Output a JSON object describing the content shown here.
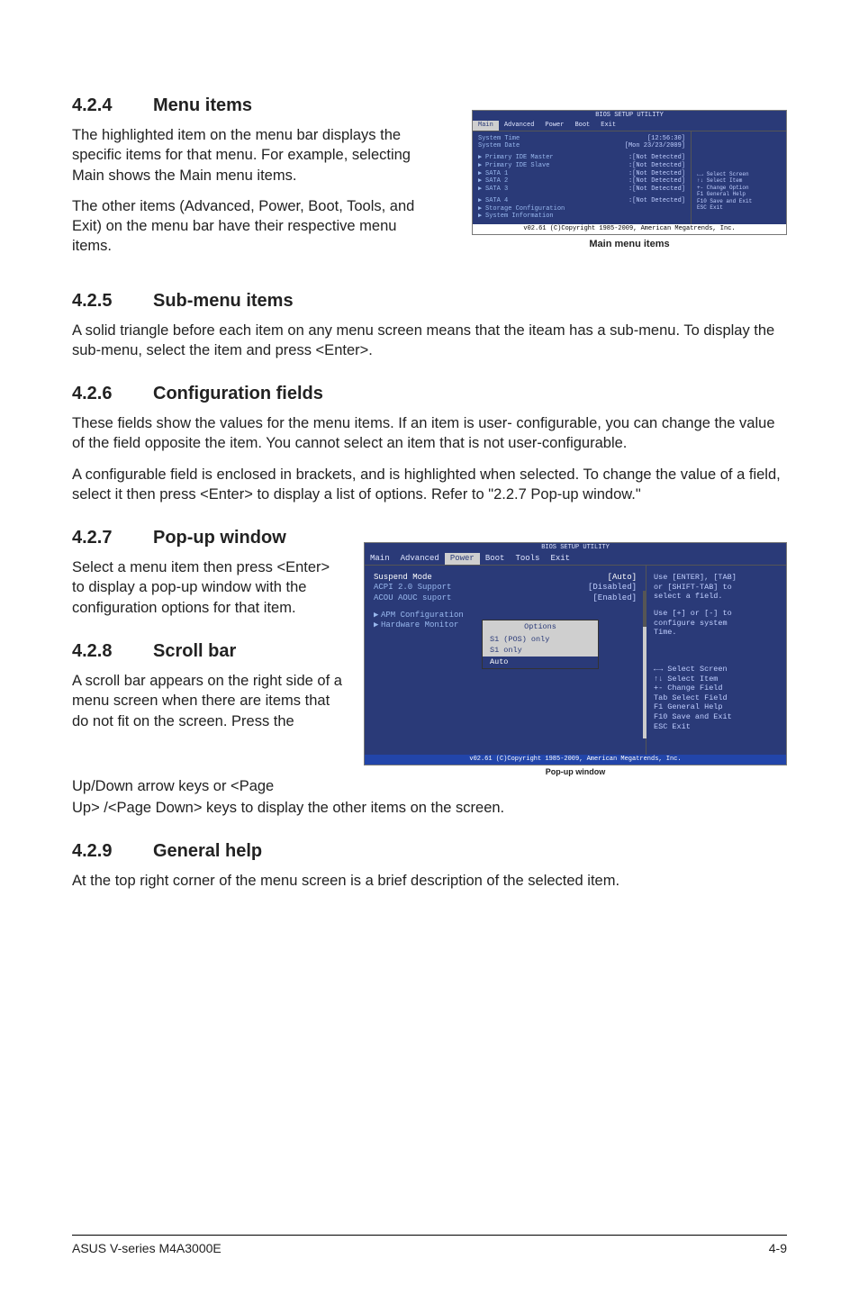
{
  "s1": {
    "num": "4.2.4",
    "title": "Menu items",
    "p1": "The highlighted item on the menu bar  displays the specific items for that menu. For example, selecting Main shows the Main menu items.",
    "p2": "The other items (Advanced, Power, Boot, Tools, and Exit) on the menu bar have their respective menu items."
  },
  "caption1": "Main menu items",
  "s2": {
    "num": "4.2.5",
    "title": "Sub-menu items",
    "p1": "A solid triangle before each item on any menu screen means that the iteam has a sub-menu. To display the sub-menu, select the item and press <Enter>."
  },
  "s3": {
    "num": "4.2.6",
    "title": "Configuration fields",
    "p1": "These fields show the values for the menu items. If an item is user- configurable, you can change the value of the field opposite the item. You cannot select an item that is not user-configurable.",
    "p2": "A configurable field is enclosed in brackets, and is highlighted when selected. To change the value of a field, select it then press <Enter> to display a list of options. Refer to \"2.2.7 Pop-up window.\""
  },
  "s4": {
    "num": "4.2.7",
    "title": "Pop-up window",
    "p1": "Select a menu item then press <Enter> to display a pop-up window with the configuration options for that item."
  },
  "s5": {
    "num": "4.2.8",
    "title": "Scroll bar",
    "p1": "A scroll bar appears on the right side of a menu screen when there are items that do not fit on the screen. Press the",
    "p2": "Up/Down arrow keys or <Page",
    "p3": "Up> /<Page Down> keys to display the other items on the screen."
  },
  "caption2": "Pop-up window",
  "s6": {
    "num": "4.2.9",
    "title": "General help",
    "p1": "At the top right corner of the menu screen is a brief description of the selected item."
  },
  "bios_small": {
    "title": "BIOS SETUP UTILITY",
    "tabs": [
      "Main",
      "Advanced",
      "Power",
      "Boot",
      "Exit"
    ],
    "rows": [
      {
        "lbl": "System Time",
        "val": "[12:56:30]"
      },
      {
        "lbl": "System Date",
        "val": "[Mon 23/23/2009]"
      }
    ],
    "submenus": [
      {
        "lbl": "Primary IDE Master",
        "val": ":[Not Detected]"
      },
      {
        "lbl": "Primary IDE Slave",
        "val": ":[Not Detected]"
      },
      {
        "lbl": "SATA 1",
        "val": ":[Not Detected]"
      },
      {
        "lbl": "SATA 2",
        "val": ":[Not Detected]"
      },
      {
        "lbl": "SATA 3",
        "val": ":[Not Detected]"
      }
    ],
    "submenus2": [
      {
        "lbl": "SATA 4",
        "val": ":[Not Detected]"
      },
      {
        "lbl": "Storage Configuration",
        "val": ""
      },
      {
        "lbl": "System Information",
        "val": ""
      }
    ],
    "help": [
      "←→   Select Screen",
      "↑↓   Select Item",
      "+-   Change Option",
      "F1   General Help",
      "F10  Save and Exit",
      "ESC  Exit"
    ],
    "footer": "v02.61 (C)Copyright 1985-2009, American Megatrends, Inc."
  },
  "bios_large": {
    "title": "BIOS SETUP UTILITY",
    "tabs": [
      "Main",
      "Advanced",
      "Power",
      "Boot",
      "Tools",
      "Exit"
    ],
    "rows": [
      {
        "lbl": "Suspend Mode",
        "val": "[Auto]",
        "hl": true
      },
      {
        "lbl": "ACPI 2.0 Support",
        "val": "[Disabled]"
      },
      {
        "lbl": "ACOU AOUC suport",
        "val": "[Enabled]"
      }
    ],
    "subs": [
      "APM Configuration",
      "Hardware Monitor"
    ],
    "popup": {
      "title": "Options",
      "opts": [
        "S1 (POS) only",
        "S1 only",
        "Auto"
      ],
      "sel": 2
    },
    "help_top": [
      "Use [ENTER], [TAB]",
      "or [SHIFT-TAB] to",
      "select a field.",
      "",
      "Use [+] or [-] to",
      "configure system",
      "Time."
    ],
    "help_bot": [
      "←→   Select Screen",
      "↑↓   Select Item",
      "+-   Change Field",
      "Tab  Select Field",
      "F1   General Help",
      "F10  Save and Exit",
      "ESC  Exit"
    ],
    "footer": "v02.61 (C)Copyright 1985-2009, American Megatrends, Inc."
  },
  "footer": {
    "left": "ASUS V-series M4A3000E",
    "right": "4-9"
  }
}
